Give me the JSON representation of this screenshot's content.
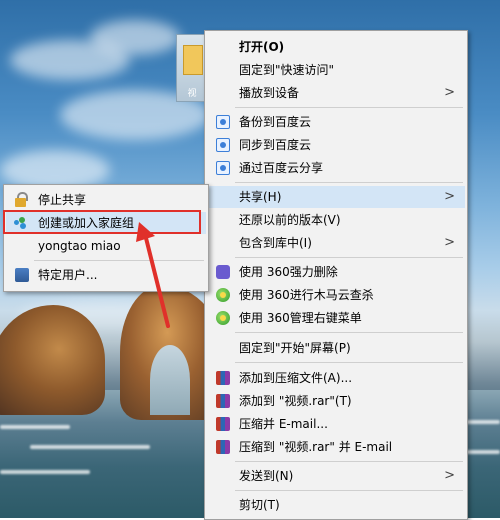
{
  "desktop": {
    "icon_label": "视"
  },
  "main_menu": {
    "open": "打开(O)",
    "pin_quick_access": "固定到\"快速访问\"",
    "cast_to_device": "播放到设备",
    "backup_baidu": "备份到百度云",
    "sync_baidu": "同步到百度云",
    "share_baidu": "通过百度云分享",
    "share": "共享(H)",
    "restore_versions": "还原以前的版本(V)",
    "include_in_library": "包含到库中(I)",
    "force_delete_360": "使用 360强力删除",
    "trojan_scan_360": "使用 360进行木马云查杀",
    "manage_menu_360": "使用 360管理右键菜单",
    "pin_start": "固定到\"开始\"屏幕(P)",
    "add_archive": "添加到压缩文件(A)...",
    "add_to_rar": "添加到 \"视频.rar\"(T)",
    "compress_email": "压缩并 E-mail...",
    "compress_rar_email": "压缩到 \"视频.rar\" 并 E-mail",
    "send_to": "发送到(N)",
    "cut": "剪切(T)"
  },
  "share_submenu": {
    "stop_sharing": "停止共享",
    "create_homegroup": "创建或加入家庭组",
    "user": "yongtao miao",
    "specific_users": "特定用户..."
  },
  "icons": {
    "submenu_arrow": "chevron-right-icon",
    "annotation": "red-arrow"
  },
  "colors": {
    "menu_bg": "#f2f2f2",
    "highlight": "#d3e5f6",
    "annotation_red": "#e0302a"
  }
}
